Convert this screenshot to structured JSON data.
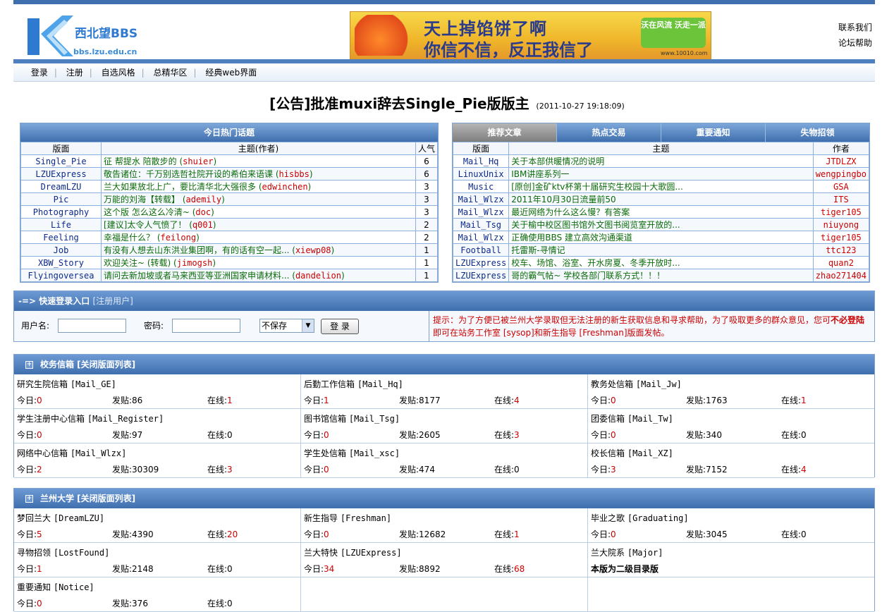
{
  "header": {
    "logo_text": "西北望BBS",
    "logo_sub": "bbs.lzu.edu.cn",
    "banner_line1": "天上掉馅饼了啊",
    "banner_line2": "你信不信，反正我信了",
    "banner_slogan": "沃在风流 沃走一派",
    "banner_url": "www.10010.com",
    "links": [
      "联系我们",
      "论坛帮助"
    ]
  },
  "nav": [
    "登录",
    "注册",
    "自选风格",
    "总精华区",
    "经典web界面"
  ],
  "announcement": {
    "title": "[公告]批准muxi辞去Single_Pie版版主",
    "date": "(2011-10-27 19:18:09)"
  },
  "hot": {
    "title": "今日热门话题",
    "headers": [
      "版面",
      "主题(作者)",
      "人气"
    ],
    "rows": [
      {
        "board": "Single_Pie",
        "topic": "征 帮提水 陪散步的",
        "author": "shuier",
        "pop": "6"
      },
      {
        "board": "LZUExpress",
        "topic": "敬告诸位：千万别选哲社院开设的希伯来语课",
        "author": "hisbbs",
        "pop": "6"
      },
      {
        "board": "DreamLZU",
        "topic": "兰大如果放北上广，要比清华北大强很多",
        "author": "edwinchen",
        "pop": "3"
      },
      {
        "board": "Pic",
        "topic": "万能的刘海【转载】",
        "author": "ademily",
        "pop": "3"
      },
      {
        "board": "Photography",
        "topic": "这个版 怎么这么冷清~",
        "author": "doc",
        "pop": "3"
      },
      {
        "board": "Life",
        "topic": "[建议]太令人气愤了！",
        "author": "q001",
        "pop": "2"
      },
      {
        "board": "Feeling",
        "topic": "幸福是什么？",
        "author": "feilong",
        "pop": "2"
      },
      {
        "board": "Job",
        "topic": "有没有人想去山东洪业集团啊，有的话有空一起...",
        "author": "xiewp08",
        "pop": "1"
      },
      {
        "board": "XBW_Story",
        "topic": "欢迎关注~ (转载)",
        "author": "jimogsh",
        "pop": "1"
      },
      {
        "board": "Flyingoversea",
        "topic": "请问去新加坡或者马来西亚等亚洲国家申请材料...",
        "author": "dandelion",
        "pop": "1"
      }
    ]
  },
  "rec": {
    "tabs": [
      "推荐文章",
      "热点交易",
      "重要通知",
      "失物招领"
    ],
    "headers": [
      "版面",
      "主题",
      "作者"
    ],
    "rows": [
      {
        "board": "Mail_Hq",
        "topic": "关于本部供暖情况的说明",
        "author": "JTDLZX"
      },
      {
        "board": "LinuxUnix",
        "topic": "IBM讲座系列一",
        "author": "wengpingbo"
      },
      {
        "board": "Music",
        "topic": "[原创]金矿ktv杯第十届研究生校园十大歌圆...",
        "author": "GSA"
      },
      {
        "board": "Mail_Wlzx",
        "topic": "2011年10月30日流量前50",
        "author": "ITS"
      },
      {
        "board": "Mail_Wlzx",
        "topic": "最近网络为什么这么慢？有答案",
        "author": "tiger105"
      },
      {
        "board": "Mail_Tsg",
        "topic": "关于榆中校区图书馆外文图书阅览室开放的...",
        "author": "niuyong"
      },
      {
        "board": "Mail_Wlzx",
        "topic": "正确使用BBS 建立高效沟通渠道",
        "author": "tiger105"
      },
      {
        "board": "Football",
        "topic": "托雷斯-寻情记",
        "author": "ttc123"
      },
      {
        "board": "LZUExpress",
        "topic": "校车、场馆、浴室、开水房夏、冬季开放时...",
        "author": "quan2"
      },
      {
        "board": "LZUExpress",
        "topic": "哥的霸气帖~ 学校各部门联系方式！！！",
        "author": "zhao271404"
      }
    ]
  },
  "login": {
    "title": "-=> 快速登录入口",
    "register": "[注册用户]",
    "user_label": "用户名:",
    "pass_label": "密码:",
    "save_option": "不保存",
    "submit": "登 录",
    "tip_red1": "提示：为了方便已被兰州大学录取但无法注册的新生获取信息和寻求帮助，为了吸取更多的群众意见，您可",
    "tip_bold": "不必登陆",
    "tip_rest": "即可在站务工作室 [sysop]和新生指导 [Freshman]版面发帖。"
  },
  "labels": {
    "today": "今日:",
    "posts": "发贴:",
    "online": "在线:"
  },
  "section1": {
    "title": "校务信箱 [关闭版面列表]",
    "cells": [
      {
        "name": "研究生院信箱",
        "en": "[Mail_GE]",
        "today": "0",
        "posts": "86",
        "online": "1"
      },
      {
        "name": "后勤工作信箱",
        "en": "[Mail_Hq]",
        "today": "1",
        "posts": "8177",
        "online": "4"
      },
      {
        "name": "教务处信箱",
        "en": "[Mail_Jw]",
        "today": "0",
        "posts": "1763",
        "online": "1"
      },
      {
        "name": "学生注册中心信箱",
        "en": "[Mail_Register]",
        "today": "0",
        "posts": "97",
        "online": "0"
      },
      {
        "name": "图书馆信箱",
        "en": "[Mail_Tsg]",
        "today": "0",
        "posts": "2605",
        "online": "3"
      },
      {
        "name": "团委信箱",
        "en": "[Mail_Tw]",
        "today": "0",
        "posts": "340",
        "online": "0"
      },
      {
        "name": "网络中心信箱",
        "en": "[Mail_Wlzx]",
        "today": "2",
        "posts": "30309",
        "online": "3"
      },
      {
        "name": "学生处信箱",
        "en": "[Mail_xsc]",
        "today": "0",
        "posts": "474",
        "online": "0"
      },
      {
        "name": "校长信箱",
        "en": "[Mail_XZ]",
        "today": "3",
        "posts": "7152",
        "online": "4"
      }
    ]
  },
  "section2": {
    "title": "兰州大学 [关闭版面列表]",
    "cells": [
      {
        "name": "梦回兰大",
        "en": "[DreamLZU]",
        "today": "5",
        "posts": "4390",
        "online": "20"
      },
      {
        "name": "新生指导",
        "en": "[Freshman]",
        "today": "0",
        "posts": "12682",
        "online": "1"
      },
      {
        "name": "毕业之歌",
        "en": "[Graduating]",
        "today": "0",
        "posts": "3045",
        "online": "0"
      },
      {
        "name": "寻物招领",
        "en": "[LostFound]",
        "today": "1",
        "posts": "2148",
        "online": "0"
      },
      {
        "name": "兰大特快",
        "en": "[LZUExpress]",
        "today": "34",
        "posts": "8892",
        "online": "68"
      },
      {
        "name": "兰大院系",
        "en": "[Major]",
        "note": "本版为二级目录版"
      },
      {
        "name": "重要通知",
        "en": "[Notice]",
        "today": "0",
        "posts": "376",
        "online": "0"
      }
    ]
  }
}
